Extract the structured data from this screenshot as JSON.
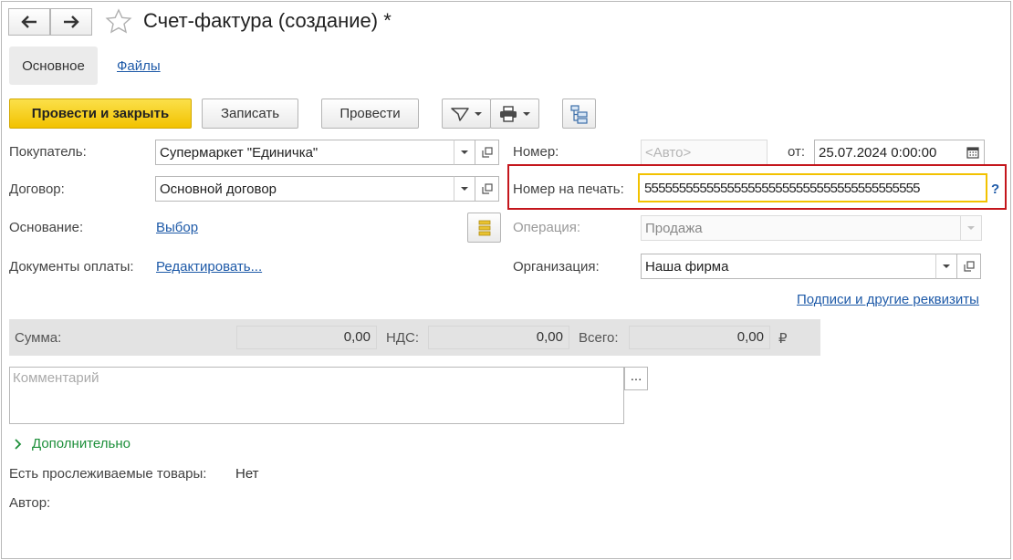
{
  "window": {
    "title": "Счет-фактура (создание) *"
  },
  "tabs": {
    "main": "Основное",
    "files": "Файлы"
  },
  "toolbar": {
    "post_close": "Провести и закрыть",
    "save": "Записать",
    "post": "Провести"
  },
  "form": {
    "buyer_label": "Покупатель:",
    "buyer_value": "Супермаркет \"Единичка\"",
    "contract_label": "Договор:",
    "contract_value": "Основной договор",
    "basis_label": "Основание:",
    "basis_link": "Выбор",
    "payments_label": "Документы оплаты:",
    "payments_link": "Редактировать...",
    "number_label": "Номер:",
    "number_placeholder": "<Авто>",
    "date_label": "от:",
    "date_value": "25.07.2024  0:00:00",
    "print_number_label": "Номер на печать:",
    "print_number_value": "5555555555555555555555555555555555555555",
    "help": "?",
    "operation_label": "Операция:",
    "operation_value": "Продажа",
    "org_label": "Организация:",
    "org_value": "Наша фирма",
    "signatures_link": "Подписи и другие реквизиты"
  },
  "totals": {
    "sum_label": "Сумма:",
    "sum_value": "0,00",
    "vat_label": "НДС:",
    "vat_value": "0,00",
    "total_label": "Всего:",
    "total_value": "0,00",
    "currency": "₽"
  },
  "comment": {
    "placeholder": "Комментарий",
    "more_button": "..."
  },
  "extra": {
    "section_label": "Дополнительно",
    "traceable_label": "Есть прослеживаемые товары:",
    "traceable_value": "Нет",
    "author_label": "Автор:"
  },
  "colors": {
    "highlight_border": "#c4161c",
    "active_field_border": "#f2c200",
    "link": "#1e5aa8",
    "section_green": "#1d8f3a"
  }
}
